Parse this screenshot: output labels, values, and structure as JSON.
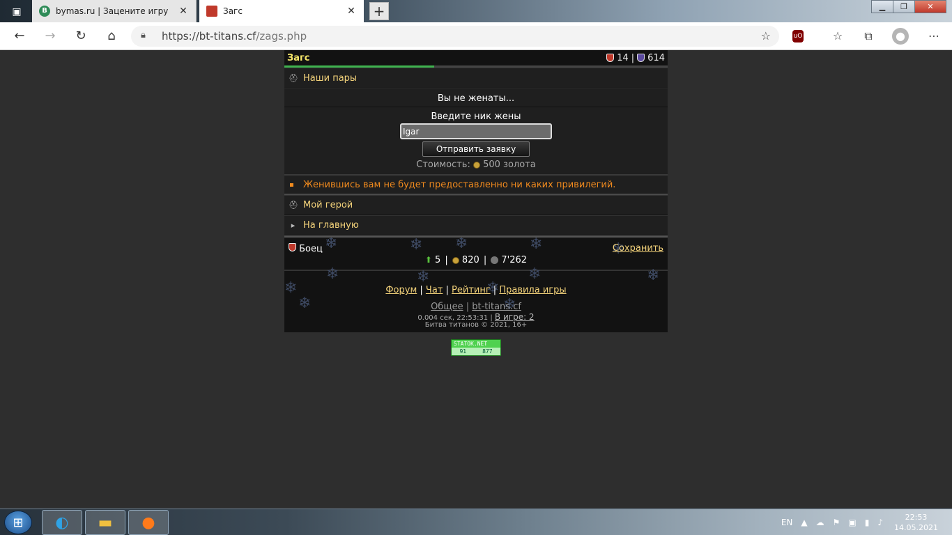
{
  "browser": {
    "tabs": [
      {
        "title": "bymas.ru | Заценитe игру",
        "favicon_letter": "B",
        "favicon_color": "#2e8b57",
        "active": false
      },
      {
        "title": "Загс",
        "favicon_letter": "",
        "favicon_color": "#c0392b",
        "active": true
      }
    ],
    "url_host": "https://bt-titans.cf",
    "url_path": "/zags.php"
  },
  "game": {
    "title": "Загс",
    "stat_red": "14",
    "stat_sep": "|",
    "stat_blue": "614",
    "progress_percent": 39,
    "our_pairs": "Наши пары",
    "status": "Вы не женаты...",
    "form_label": "Введите ник жены",
    "input_value": "Igar",
    "submit_label": "Отправить заявку",
    "cost_label": "Стоимость:",
    "cost_value": "500 золота",
    "note": "Женившись вам не будет предоставленно ни каких привилегий.",
    "links": [
      "Мой герой",
      "На главную"
    ],
    "player": {
      "name": "Боец",
      "save_label": "Сохранить",
      "level": "5",
      "gold": "820",
      "power": "7'262"
    },
    "menu": [
      "Форум",
      "Чат",
      "Рейтинг",
      "Правила игры"
    ],
    "misc": [
      "Общее",
      "bt-titans.cf"
    ],
    "time_text": "0.004 сек, 22:53:31 |",
    "online_label": "В игре: 2",
    "copyright": "Битва титанов © 2021, 16+",
    "counter": {
      "brand": "STATOK.NET",
      "left": "91",
      "right": "877"
    }
  },
  "taskbar": {
    "lang": "EN",
    "time": "22:53",
    "date": "14.05.2021"
  }
}
